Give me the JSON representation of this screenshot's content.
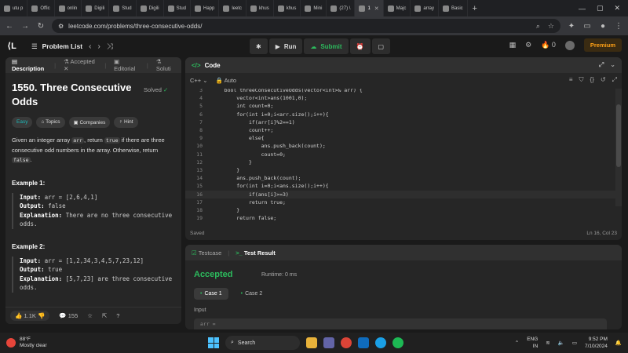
{
  "browser": {
    "tabs": [
      {
        "label": "utu p",
        "active": false
      },
      {
        "label": "Offic",
        "active": false
      },
      {
        "label": "onlin",
        "active": false
      },
      {
        "label": "Digili",
        "active": false
      },
      {
        "label": "Stud",
        "active": false
      },
      {
        "label": "Digili",
        "active": false
      },
      {
        "label": "Stud",
        "active": false
      },
      {
        "label": "Happ",
        "active": false
      },
      {
        "label": "leetc",
        "active": false
      },
      {
        "label": "khus",
        "active": false
      },
      {
        "label": "khus",
        "active": false
      },
      {
        "label": "Mini",
        "active": false
      },
      {
        "label": "(27) \\",
        "active": false
      },
      {
        "label": "1",
        "active": true
      },
      {
        "label": "Majc",
        "active": false
      },
      {
        "label": "array",
        "active": false
      },
      {
        "label": "Basic",
        "active": false
      }
    ],
    "url": "leetcode.com/problems/three-consecutive-odds/"
  },
  "header": {
    "problem_list": "Problem List",
    "run": "Run",
    "submit": "Submit",
    "streak": "0",
    "premium": "Premium"
  },
  "problem": {
    "tabs": [
      "Description",
      "Accepted",
      "Editorial",
      "Soluti"
    ],
    "title": "1550. Three Consecutive Odds",
    "solved": "Solved",
    "chips": [
      "Easy",
      "Topics",
      "Companies",
      "Hint"
    ],
    "desc_1": "Given an integer array ",
    "desc_arr": "arr",
    "desc_2": ", return ",
    "desc_true": "true",
    "desc_3": " if there are three consecutive odd numbers in the array. Otherwise, return ",
    "desc_false": "false",
    "desc_4": ".",
    "example1_head": "Example 1:",
    "example1_input": "arr = [2,6,4,1]",
    "example1_output": "false",
    "example1_expl": "There are no three consecutive odds.",
    "example2_head": "Example 2:",
    "example2_input": "arr = [1,2,34,3,4,5,7,23,12]",
    "example2_output": "true",
    "example2_expl": "[5,7,23] are three consecutive odds.",
    "label_input": "Input:",
    "label_output": "Output:",
    "label_expl": "Explanation:",
    "likes": "1.1K",
    "comments": "155"
  },
  "code": {
    "title": "Code",
    "lang": "C++",
    "auto": "Auto",
    "saved": "Saved",
    "cursor": "Ln 16, Col 23",
    "current_line": 16,
    "lines": [
      {
        "n": "3",
        "t": "    bool threeConsecutiveOdds(vector<int>& arr) {"
      },
      {
        "n": "4",
        "t": "        vector<int>ans(1001,0);"
      },
      {
        "n": "5",
        "t": "        int count=0;"
      },
      {
        "n": "6",
        "t": "        for(int i=0;i<arr.size();i++){"
      },
      {
        "n": "7",
        "t": "            if(arr[i]%2==1)"
      },
      {
        "n": "8",
        "t": "            count++;"
      },
      {
        "n": "9",
        "t": "            else{"
      },
      {
        "n": "10",
        "t": "                ans.push_back(count);"
      },
      {
        "n": "11",
        "t": "                count=0;"
      },
      {
        "n": "12",
        "t": "            }"
      },
      {
        "n": "13",
        "t": "        }"
      },
      {
        "n": "14",
        "t": "        ans.push_back(count);"
      },
      {
        "n": "15",
        "t": "        for(int i=0;i<ans.size();i++){"
      },
      {
        "n": "16",
        "t": "            if(ans[i]>=3)"
      },
      {
        "n": "17",
        "t": "            return true;"
      },
      {
        "n": "18",
        "t": "        }"
      },
      {
        "n": "19",
        "t": "        return false;"
      }
    ]
  },
  "result": {
    "tab_testcase": "Testcase",
    "tab_result": "Test Result",
    "status": "Accepted",
    "runtime": "Runtime: 0 ms",
    "cases": [
      "Case 1",
      "Case 2"
    ],
    "input_label": "Input",
    "input_value": "arr ="
  },
  "taskbar": {
    "temp": "88°F",
    "weather": "Mostly clear",
    "search": "Search",
    "lang": "ENG",
    "region": "IN",
    "time": "9:52 PM",
    "date": "7/10/2024"
  }
}
